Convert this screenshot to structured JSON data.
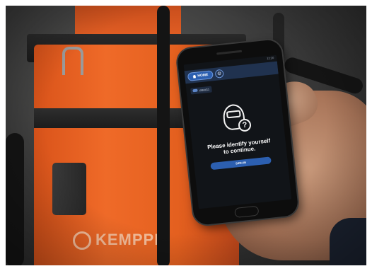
{
  "photo": {
    "machine_brand": "KEMPPI"
  },
  "phone_app": {
    "status_time": "12:20",
    "home_label": "HOME",
    "device_label": "X8MIG1",
    "prompt_line1": "Please identify yourself",
    "prompt_line2": "to continue.",
    "sign_in_label": "SIGN IN",
    "colors": {
      "app_bar": "#20324f",
      "primary_button": "#2c5fb0",
      "screen_bg": "#111418"
    },
    "icons": [
      "home-icon",
      "settings-icon",
      "toggle-icon",
      "welding-helmet-icon",
      "question-mark-icon"
    ]
  },
  "colors": {
    "machine_orange": "#ef6a28"
  }
}
